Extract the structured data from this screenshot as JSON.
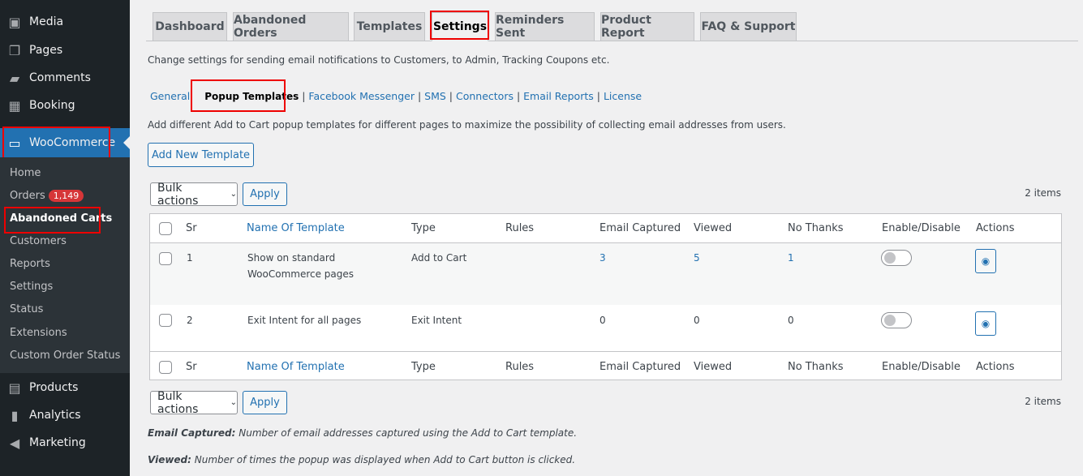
{
  "sidebar": {
    "items": [
      {
        "label": "Media",
        "icon": "media-icon"
      },
      {
        "label": "Pages",
        "icon": "pages-icon"
      },
      {
        "label": "Comments",
        "icon": "comments-icon"
      },
      {
        "label": "Booking",
        "icon": "calendar-icon"
      }
    ],
    "woo": "WooCommerce",
    "sub": [
      "Home",
      "Orders",
      "Abandoned Carts",
      "Customers",
      "Reports",
      "Settings",
      "Status",
      "Extensions",
      "Custom Order Status"
    ],
    "orders_badge": "1,149",
    "bottom": [
      {
        "label": "Products",
        "icon": "products-icon"
      },
      {
        "label": "Analytics",
        "icon": "analytics-icon"
      },
      {
        "label": "Marketing",
        "icon": "marketing-icon"
      }
    ]
  },
  "tabs": [
    "Dashboard",
    "Abandoned Orders",
    "Templates",
    "Settings",
    "Reminders Sent",
    "Product Report",
    "FAQ & Support"
  ],
  "desc": "Change settings for sending email notifications to Customers, to Admin, Tracking Coupons etc.",
  "subnav": [
    "General",
    "Popup Templates",
    "Facebook Messenger",
    "SMS",
    "Connectors",
    "Email Reports",
    "License"
  ],
  "intro": "Add different Add to Cart popup templates for different pages to maximize the possibility of collecting email addresses from users.",
  "add_button": "Add New Template",
  "bulk": "Bulk actions",
  "apply": "Apply",
  "count": "2 items",
  "columns": [
    "Sr",
    "Name Of Template",
    "Type",
    "Rules",
    "Email Captured",
    "Viewed",
    "No Thanks",
    "Enable/Disable",
    "Actions"
  ],
  "rows": [
    {
      "sr": "1",
      "name": "Show on standard",
      "name2": "WooCommerce pages",
      "type": "Add to Cart",
      "email": "3",
      "viewed": "5",
      "nothanks": "1",
      "enabled": false
    },
    {
      "sr": "2",
      "name": "Exit Intent for all pages",
      "name2": "",
      "type": "Exit Intent",
      "email": "0",
      "viewed": "0",
      "nothanks": "0",
      "enabled": false
    }
  ],
  "notes": [
    {
      "term": "Email Captured:",
      "text": " Number of email addresses captured using the Add to Cart template."
    },
    {
      "term": "Viewed:",
      "text": " Number of times the popup was displayed when Add to Cart button is clicked."
    }
  ]
}
